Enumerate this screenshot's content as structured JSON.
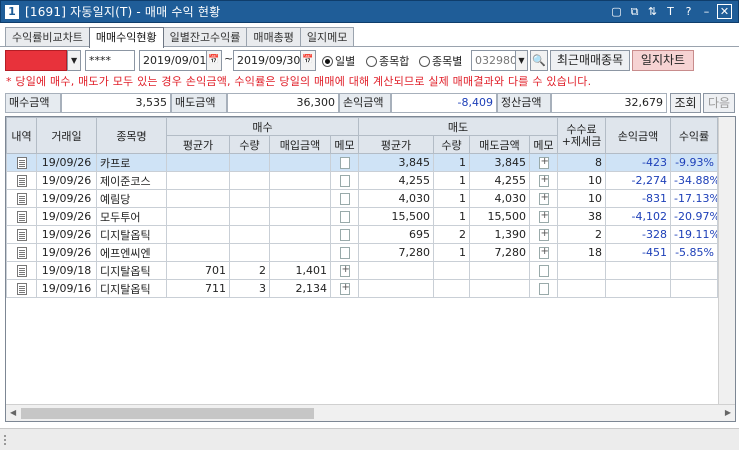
{
  "window": {
    "badge": "1",
    "title": "[1691] 자동일지(T) - 매매 수익 현황",
    "icons": [
      "layout-icon",
      "restore-icon",
      "pin-icon",
      "font-icon",
      "help-icon",
      "minimize-icon",
      "close-icon"
    ]
  },
  "tabs": [
    {
      "label": "수익률비교차트",
      "active": false
    },
    {
      "label": "매매수익현황",
      "active": true
    },
    {
      "label": "일별잔고수익률",
      "active": false
    },
    {
      "label": "매매총평",
      "active": false
    },
    {
      "label": "일지메모",
      "active": false
    }
  ],
  "controls": {
    "password": "****",
    "date_from": "2019/09/01",
    "date_to": "2019/09/30",
    "tilde": "~",
    "radio_daily": "일별",
    "radio_sum": "종목합",
    "radio_by_item": "종목별",
    "code_value": "032980",
    "recent_button": "최근매매종목",
    "chart_button": "일지차트"
  },
  "notice": "* 당일에 매수, 매도가 모두 있는 경우 손익금액, 수익률은 당일의 매매에 대해 계산되므로 실제 매매결과와 다를 수 있습니다.",
  "summary": {
    "buy_label": "매수금액",
    "buy_value": "3,535",
    "sell_label": "매도금액",
    "sell_value": "36,300",
    "pl_label": "손익금액",
    "pl_value": "-8,409",
    "settle_label": "정산금액",
    "settle_value": "32,679",
    "query_button": "조회",
    "next_button": "다음"
  },
  "grid": {
    "headers": {
      "detail": "내역",
      "date": "거래일",
      "name": "종목명",
      "buy_group": "매수",
      "sell_group": "매도",
      "fee_tax_1": "수수료",
      "fee_tax_2": "+제세금",
      "pl": "손익금액",
      "rate": "수익률",
      "avg_price": "평균가",
      "qty": "수량",
      "buy_amt": "매입금액",
      "memo": "메모",
      "sell_avg": "평균가",
      "sell_qty": "수량",
      "sell_amt": "매도금액",
      "sell_memo": "메모"
    },
    "rows": [
      {
        "date": "19/09/26",
        "name": "카프로",
        "b_avg": "",
        "b_qty": "",
        "b_amt": "",
        "s_avg": "3,845",
        "s_qty": "1",
        "s_amt": "3,845",
        "fee": "8",
        "pl": "-423",
        "rate": "-9.93%",
        "buy_memo": "none",
        "sell_memo": "plus",
        "selected": true
      },
      {
        "date": "19/09/26",
        "name": "제이준코스",
        "b_avg": "",
        "b_qty": "",
        "b_amt": "",
        "s_avg": "4,255",
        "s_qty": "1",
        "s_amt": "4,255",
        "fee": "10",
        "pl": "-2,274",
        "rate": "-34.88%",
        "buy_memo": "none",
        "sell_memo": "plus",
        "selected": false
      },
      {
        "date": "19/09/26",
        "name": "예림당",
        "b_avg": "",
        "b_qty": "",
        "b_amt": "",
        "s_avg": "4,030",
        "s_qty": "1",
        "s_amt": "4,030",
        "fee": "10",
        "pl": "-831",
        "rate": "-17.13%",
        "buy_memo": "none",
        "sell_memo": "plus",
        "selected": false
      },
      {
        "date": "19/09/26",
        "name": "모두투어",
        "b_avg": "",
        "b_qty": "",
        "b_amt": "",
        "s_avg": "15,500",
        "s_qty": "1",
        "s_amt": "15,500",
        "fee": "38",
        "pl": "-4,102",
        "rate": "-20.97%",
        "buy_memo": "none",
        "sell_memo": "plus",
        "selected": false
      },
      {
        "date": "19/09/26",
        "name": "디지탈옵틱",
        "b_avg": "",
        "b_qty": "",
        "b_amt": "",
        "s_avg": "695",
        "s_qty": "2",
        "s_amt": "1,390",
        "fee": "2",
        "pl": "-328",
        "rate": "-19.11%",
        "buy_memo": "none",
        "sell_memo": "plus",
        "selected": false
      },
      {
        "date": "19/09/26",
        "name": "에프엔씨엔",
        "b_avg": "",
        "b_qty": "",
        "b_amt": "",
        "s_avg": "7,280",
        "s_qty": "1",
        "s_amt": "7,280",
        "fee": "18",
        "pl": "-451",
        "rate": "-5.85%",
        "buy_memo": "none",
        "sell_memo": "plus",
        "selected": false
      },
      {
        "date": "19/09/18",
        "name": "디지탈옵틱",
        "b_avg": "701",
        "b_qty": "2",
        "b_amt": "1,401",
        "s_avg": "",
        "s_qty": "",
        "s_amt": "",
        "fee": "",
        "pl": "",
        "rate": "",
        "buy_memo": "plus",
        "sell_memo": "none",
        "selected": false
      },
      {
        "date": "19/09/16",
        "name": "디지탈옵틱",
        "b_avg": "711",
        "b_qty": "3",
        "b_amt": "2,134",
        "s_avg": "",
        "s_qty": "",
        "s_amt": "",
        "fee": "",
        "pl": "",
        "rate": "",
        "buy_memo": "plus",
        "sell_memo": "none",
        "selected": false
      }
    ]
  },
  "colors": {
    "titlebar": "#1f5d98",
    "notice": "#e0202a",
    "negative": "#1d3fb8",
    "selected_row": "#cfe3f6",
    "header_bg": "#dfe5ec"
  }
}
